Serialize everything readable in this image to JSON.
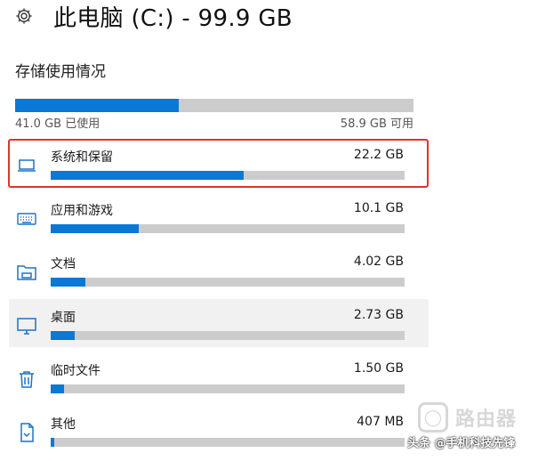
{
  "header": {
    "icon": "gear-icon",
    "title": "此电脑 (C:) - 99.9 GB"
  },
  "section_title": "存储使用情况",
  "storage": {
    "used_label": "41.0 GB 已使用",
    "free_label": "58.9 GB 可用",
    "used_fraction": 0.41
  },
  "categories": [
    {
      "label": "系统和保留",
      "size": "22.2 GB",
      "fraction": 0.545,
      "icon": "laptop-icon"
    },
    {
      "label": "应用和游戏",
      "size": "10.1 GB",
      "fraction": 0.248,
      "icon": "keyboard-icon"
    },
    {
      "label": "文档",
      "size": "4.02 GB",
      "fraction": 0.098,
      "icon": "folder-icon"
    },
    {
      "label": "桌面",
      "size": "2.73 GB",
      "fraction": 0.067,
      "icon": "monitor-icon"
    },
    {
      "label": "临时文件",
      "size": "1.50 GB",
      "fraction": 0.037,
      "icon": "trash-icon"
    },
    {
      "label": "其他",
      "size": "407 MB",
      "fraction": 0.01,
      "icon": "document-icon"
    }
  ],
  "watermark": {
    "text": "路由器",
    "credit": "头条 @手机科技先锋"
  },
  "colors": {
    "accent": "#0a78d4",
    "highlight_border": "#e0322d"
  }
}
